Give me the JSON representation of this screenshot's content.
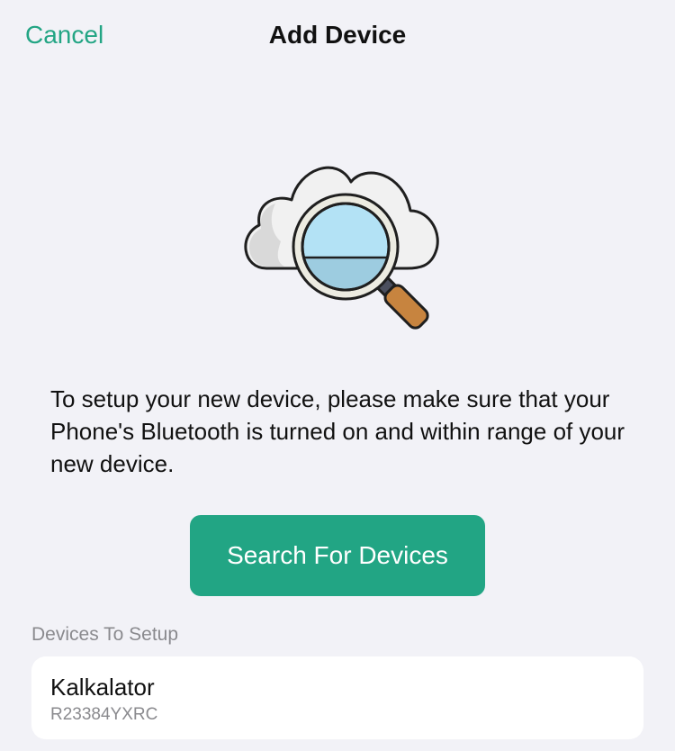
{
  "nav": {
    "cancel_label": "Cancel",
    "title": "Add Device"
  },
  "illustration": {
    "icon": "cloud-search-icon"
  },
  "instructions": {
    "text": "To setup your new device, please make sure that your Phone's Bluetooth is turned on and within range of your new device."
  },
  "search_button": {
    "label": "Search For Devices"
  },
  "devices_section": {
    "header": "Devices To Setup",
    "devices": [
      {
        "name": "Kalkalator",
        "serial": "R23384YXRC"
      }
    ]
  },
  "colors": {
    "accent": "#23a584",
    "background": "#f2f2f7",
    "card": "#ffffff",
    "secondary_text": "#8a8a8e"
  }
}
